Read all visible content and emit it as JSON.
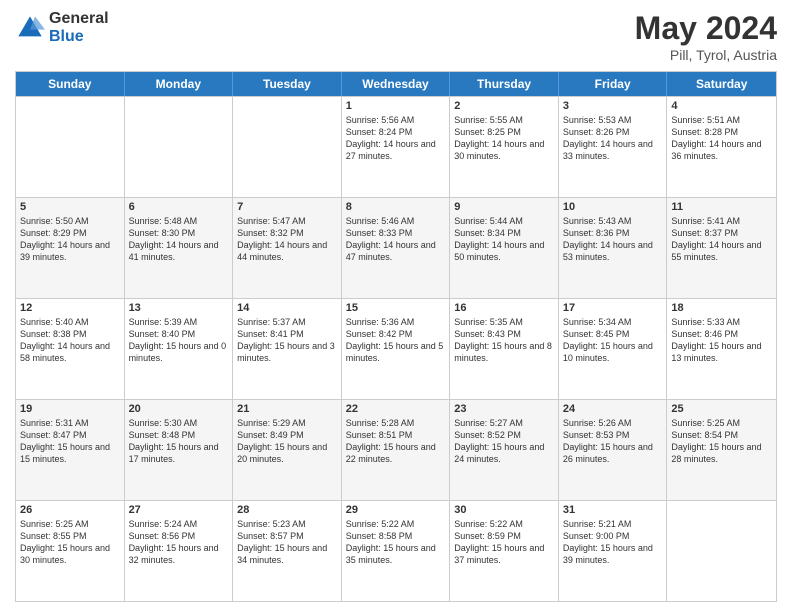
{
  "header": {
    "logo_general": "General",
    "logo_blue": "Blue",
    "month_year": "May 2024",
    "location": "Pill, Tyrol, Austria"
  },
  "weekdays": [
    "Sunday",
    "Monday",
    "Tuesday",
    "Wednesday",
    "Thursday",
    "Friday",
    "Saturday"
  ],
  "rows": [
    [
      {
        "day": "",
        "info": ""
      },
      {
        "day": "",
        "info": ""
      },
      {
        "day": "",
        "info": ""
      },
      {
        "day": "1",
        "info": "Sunrise: 5:56 AM\nSunset: 8:24 PM\nDaylight: 14 hours\nand 27 minutes."
      },
      {
        "day": "2",
        "info": "Sunrise: 5:55 AM\nSunset: 8:25 PM\nDaylight: 14 hours\nand 30 minutes."
      },
      {
        "day": "3",
        "info": "Sunrise: 5:53 AM\nSunset: 8:26 PM\nDaylight: 14 hours\nand 33 minutes."
      },
      {
        "day": "4",
        "info": "Sunrise: 5:51 AM\nSunset: 8:28 PM\nDaylight: 14 hours\nand 36 minutes."
      }
    ],
    [
      {
        "day": "5",
        "info": "Sunrise: 5:50 AM\nSunset: 8:29 PM\nDaylight: 14 hours\nand 39 minutes."
      },
      {
        "day": "6",
        "info": "Sunrise: 5:48 AM\nSunset: 8:30 PM\nDaylight: 14 hours\nand 41 minutes."
      },
      {
        "day": "7",
        "info": "Sunrise: 5:47 AM\nSunset: 8:32 PM\nDaylight: 14 hours\nand 44 minutes."
      },
      {
        "day": "8",
        "info": "Sunrise: 5:46 AM\nSunset: 8:33 PM\nDaylight: 14 hours\nand 47 minutes."
      },
      {
        "day": "9",
        "info": "Sunrise: 5:44 AM\nSunset: 8:34 PM\nDaylight: 14 hours\nand 50 minutes."
      },
      {
        "day": "10",
        "info": "Sunrise: 5:43 AM\nSunset: 8:36 PM\nDaylight: 14 hours\nand 53 minutes."
      },
      {
        "day": "11",
        "info": "Sunrise: 5:41 AM\nSunset: 8:37 PM\nDaylight: 14 hours\nand 55 minutes."
      }
    ],
    [
      {
        "day": "12",
        "info": "Sunrise: 5:40 AM\nSunset: 8:38 PM\nDaylight: 14 hours\nand 58 minutes."
      },
      {
        "day": "13",
        "info": "Sunrise: 5:39 AM\nSunset: 8:40 PM\nDaylight: 15 hours\nand 0 minutes."
      },
      {
        "day": "14",
        "info": "Sunrise: 5:37 AM\nSunset: 8:41 PM\nDaylight: 15 hours\nand 3 minutes."
      },
      {
        "day": "15",
        "info": "Sunrise: 5:36 AM\nSunset: 8:42 PM\nDaylight: 15 hours\nand 5 minutes."
      },
      {
        "day": "16",
        "info": "Sunrise: 5:35 AM\nSunset: 8:43 PM\nDaylight: 15 hours\nand 8 minutes."
      },
      {
        "day": "17",
        "info": "Sunrise: 5:34 AM\nSunset: 8:45 PM\nDaylight: 15 hours\nand 10 minutes."
      },
      {
        "day": "18",
        "info": "Sunrise: 5:33 AM\nSunset: 8:46 PM\nDaylight: 15 hours\nand 13 minutes."
      }
    ],
    [
      {
        "day": "19",
        "info": "Sunrise: 5:31 AM\nSunset: 8:47 PM\nDaylight: 15 hours\nand 15 minutes."
      },
      {
        "day": "20",
        "info": "Sunrise: 5:30 AM\nSunset: 8:48 PM\nDaylight: 15 hours\nand 17 minutes."
      },
      {
        "day": "21",
        "info": "Sunrise: 5:29 AM\nSunset: 8:49 PM\nDaylight: 15 hours\nand 20 minutes."
      },
      {
        "day": "22",
        "info": "Sunrise: 5:28 AM\nSunset: 8:51 PM\nDaylight: 15 hours\nand 22 minutes."
      },
      {
        "day": "23",
        "info": "Sunrise: 5:27 AM\nSunset: 8:52 PM\nDaylight: 15 hours\nand 24 minutes."
      },
      {
        "day": "24",
        "info": "Sunrise: 5:26 AM\nSunset: 8:53 PM\nDaylight: 15 hours\nand 26 minutes."
      },
      {
        "day": "25",
        "info": "Sunrise: 5:25 AM\nSunset: 8:54 PM\nDaylight: 15 hours\nand 28 minutes."
      }
    ],
    [
      {
        "day": "26",
        "info": "Sunrise: 5:25 AM\nSunset: 8:55 PM\nDaylight: 15 hours\nand 30 minutes."
      },
      {
        "day": "27",
        "info": "Sunrise: 5:24 AM\nSunset: 8:56 PM\nDaylight: 15 hours\nand 32 minutes."
      },
      {
        "day": "28",
        "info": "Sunrise: 5:23 AM\nSunset: 8:57 PM\nDaylight: 15 hours\nand 34 minutes."
      },
      {
        "day": "29",
        "info": "Sunrise: 5:22 AM\nSunset: 8:58 PM\nDaylight: 15 hours\nand 35 minutes."
      },
      {
        "day": "30",
        "info": "Sunrise: 5:22 AM\nSunset: 8:59 PM\nDaylight: 15 hours\nand 37 minutes."
      },
      {
        "day": "31",
        "info": "Sunrise: 5:21 AM\nSunset: 9:00 PM\nDaylight: 15 hours\nand 39 minutes."
      },
      {
        "day": "",
        "info": ""
      }
    ]
  ],
  "colors": {
    "header_bg": "#2979c0",
    "alt_row_bg": "#f5f5f5",
    "border": "#cccccc"
  }
}
